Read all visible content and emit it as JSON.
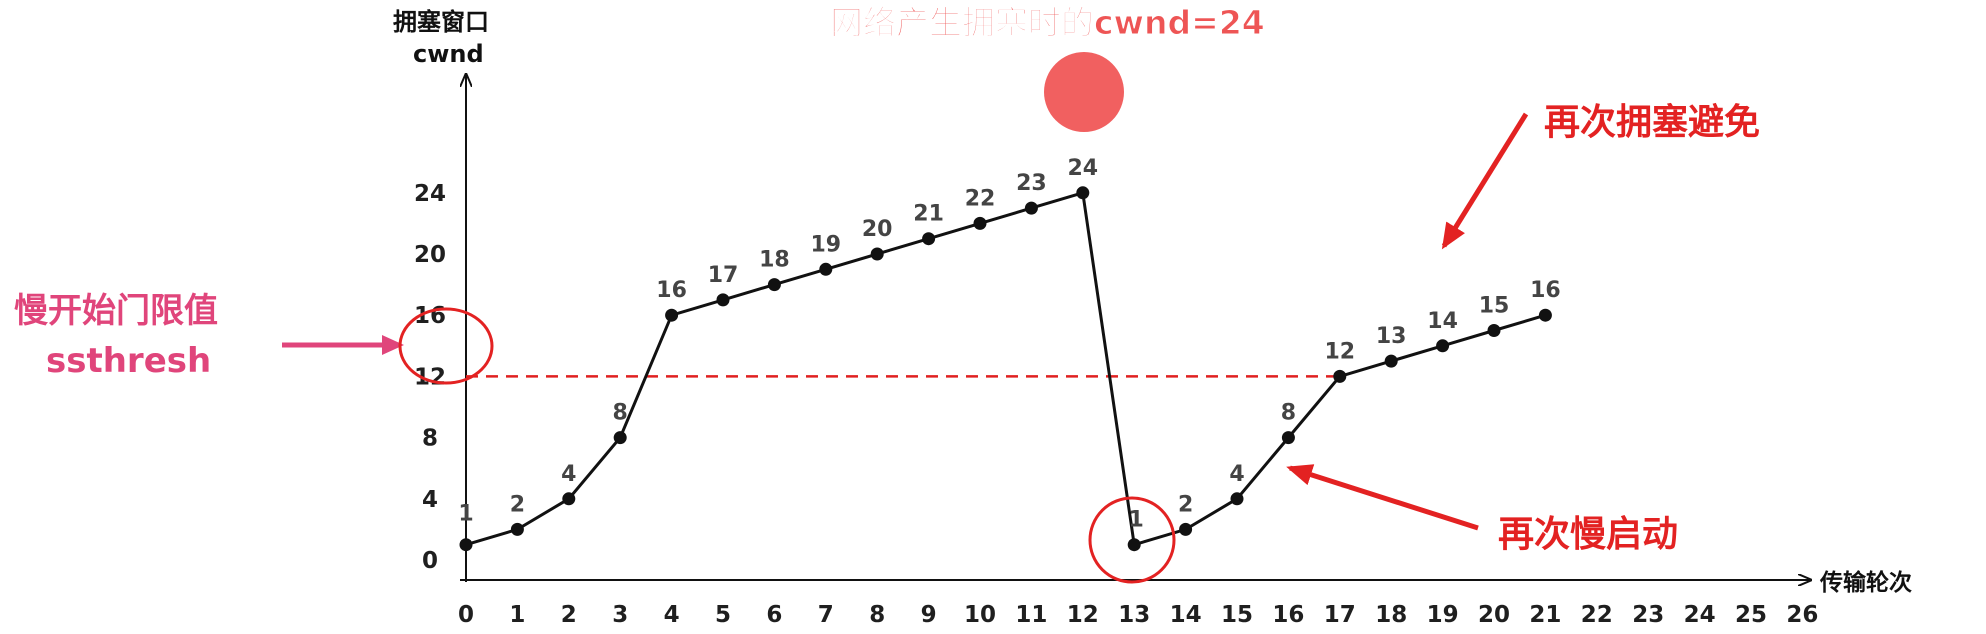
{
  "chart_data": {
    "type": "line",
    "title": "网络产生拥塞时的cwnd=24",
    "ylabel_line1": "拥塞窗口",
    "ylabel_line2": "cwnd",
    "xlabel": "传输轮次",
    "x_ticks": [
      0,
      1,
      2,
      3,
      4,
      5,
      6,
      7,
      8,
      9,
      10,
      11,
      12,
      13,
      14,
      15,
      16,
      17,
      18,
      19,
      20,
      21,
      22,
      23,
      24,
      25,
      26
    ],
    "y_ticks": [
      0,
      4,
      8,
      12,
      16,
      20,
      24
    ],
    "xlim": [
      0,
      26
    ],
    "ylim": [
      0,
      26
    ],
    "ssthresh": 12,
    "series": [
      {
        "points": [
          [
            0,
            1
          ],
          [
            1,
            2
          ],
          [
            2,
            4
          ],
          [
            3,
            8
          ],
          [
            4,
            16
          ],
          [
            5,
            17
          ],
          [
            6,
            18
          ],
          [
            7,
            19
          ],
          [
            8,
            20
          ],
          [
            9,
            21
          ],
          [
            10,
            22
          ],
          [
            11,
            23
          ],
          [
            12,
            24
          ],
          [
            13,
            1
          ],
          [
            14,
            2
          ],
          [
            15,
            4
          ],
          [
            16,
            8
          ],
          [
            17,
            12
          ],
          [
            18,
            13
          ],
          [
            19,
            14
          ],
          [
            20,
            15
          ],
          [
            21,
            16
          ]
        ]
      }
    ],
    "annotations": {
      "ssthresh_line1": "慢开始门限值",
      "ssthresh_line2": "ssthresh",
      "slow_start_again": "再次慢启动",
      "congestion_avoidance_again": "再次拥塞避免"
    },
    "colors": {
      "line": "#111111",
      "threshold": "#e02020",
      "highlight": "#ee4444",
      "ssthresh_text": "#e0457b",
      "arrow_red": "#e32222",
      "arrow_pink": "#e0457b"
    }
  }
}
